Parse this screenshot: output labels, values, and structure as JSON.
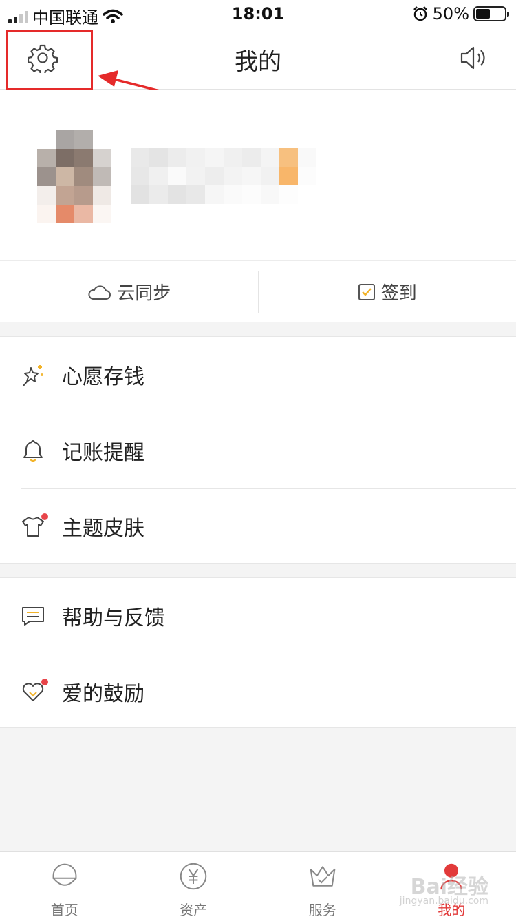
{
  "status_bar": {
    "carrier": "中国联通",
    "time": "18:01",
    "battery_percent": "50%",
    "battery_level": 0.5,
    "icons": [
      "signal-icon",
      "wifi-icon",
      "alarm-icon",
      "battery-icon"
    ]
  },
  "nav": {
    "title": "我的",
    "left_icon": "gear-icon",
    "right_icon": "speaker-icon"
  },
  "actions": [
    {
      "label": "云同步",
      "icon": "cloud-icon"
    },
    {
      "label": "签到",
      "icon": "checkbox-icon"
    }
  ],
  "menu_group_1": [
    {
      "label": "心愿存钱",
      "icon": "sparkle-star-icon",
      "badge": false
    },
    {
      "label": "记账提醒",
      "icon": "bell-icon",
      "badge": false
    },
    {
      "label": "主题皮肤",
      "icon": "tshirt-icon",
      "badge": true
    }
  ],
  "menu_group_2": [
    {
      "label": "帮助与反馈",
      "icon": "message-icon",
      "badge": false
    },
    {
      "label": "爱的鼓励",
      "icon": "heart-icon",
      "badge": true
    }
  ],
  "tabs": [
    {
      "label": "首页",
      "icon": "home-icon",
      "active": false
    },
    {
      "label": "资产",
      "icon": "yen-coin-icon",
      "active": false
    },
    {
      "label": "服务",
      "icon": "crown-icon",
      "active": false
    },
    {
      "label": "我的",
      "icon": "user-icon",
      "active": true
    }
  ],
  "watermark": {
    "main": "Bai经验",
    "sub": "jingyan.baidu.com"
  },
  "colors": {
    "accent_red": "#e23a3a",
    "highlight_box": "#e52a2a",
    "icon_gold": "#f2b329",
    "background": "#f4f4f4"
  }
}
